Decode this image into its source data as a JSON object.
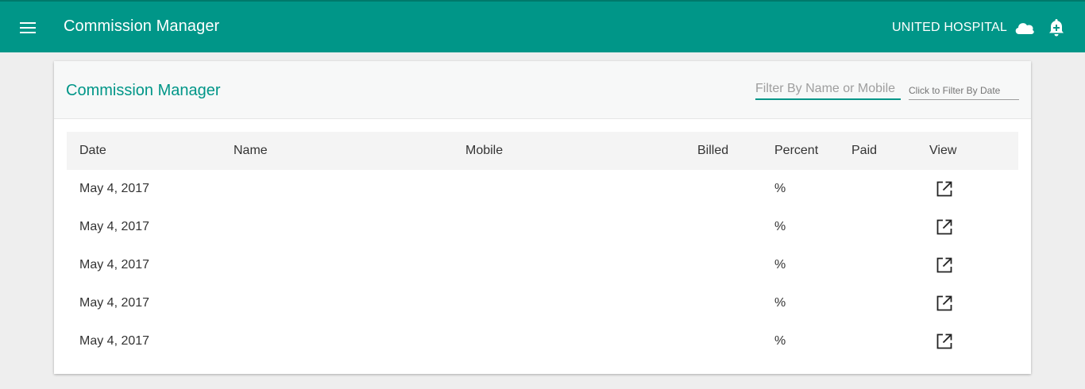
{
  "colors": {
    "primary": "#009688",
    "primary_dark": "#00796b",
    "background": "#eeeeee"
  },
  "topbar": {
    "menu_icon": "hamburger-menu-icon",
    "title": "Commission Manager",
    "organization": "UNITED HOSPITAL",
    "cloud_icon": "cloud-icon",
    "alarm_icon": "alarm-add-icon"
  },
  "card": {
    "title": "Commission Manager",
    "filter_name_placeholder": "Filter By Name or Mobile",
    "filter_date_placeholder": "Click to Filter By Date"
  },
  "table": {
    "headers": {
      "date": "Date",
      "name": "Name",
      "mobile": "Mobile",
      "billed": "Billed",
      "percent": "Percent",
      "paid": "Paid",
      "view": "View"
    },
    "rows": [
      {
        "date": "May 4, 2017",
        "name": "",
        "mobile": "",
        "billed": "",
        "percent": "%",
        "paid": "",
        "view_icon": "open-in-new-icon"
      },
      {
        "date": "May 4, 2017",
        "name": "",
        "mobile": "",
        "billed": "",
        "percent": "%",
        "paid": "",
        "view_icon": "open-in-new-icon"
      },
      {
        "date": "May 4, 2017",
        "name": "",
        "mobile": "",
        "billed": "",
        "percent": "%",
        "paid": "",
        "view_icon": "open-in-new-icon"
      },
      {
        "date": "May 4, 2017",
        "name": "",
        "mobile": "",
        "billed": "",
        "percent": "%",
        "paid": "",
        "view_icon": "open-in-new-icon"
      },
      {
        "date": "May 4, 2017",
        "name": "",
        "mobile": "",
        "billed": "",
        "percent": "%",
        "paid": "",
        "view_icon": "open-in-new-icon"
      }
    ]
  }
}
